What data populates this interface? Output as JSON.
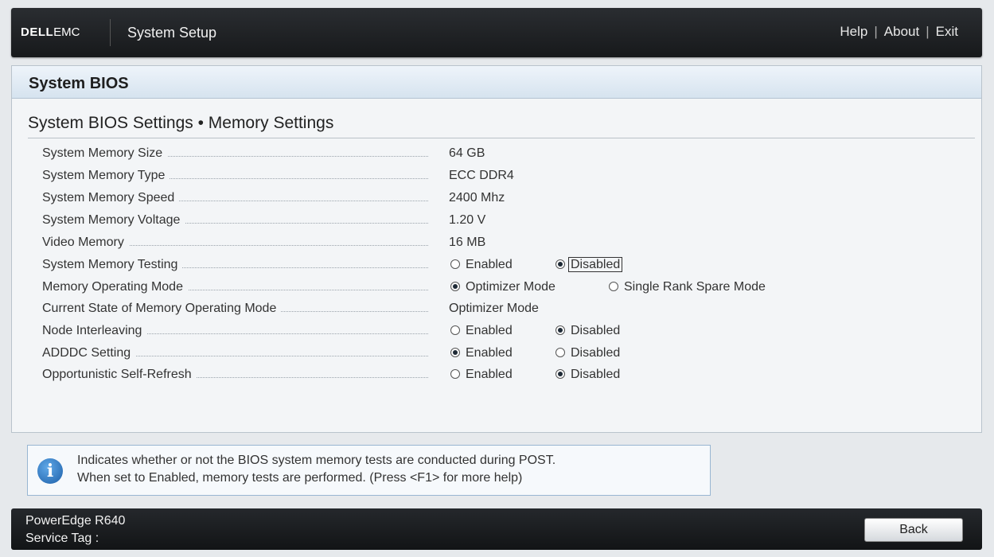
{
  "header": {
    "logo_dell": "DELL",
    "logo_emc": "EMC",
    "app_title": "System Setup",
    "links": [
      "Help",
      "About",
      "Exit"
    ],
    "separator": "|"
  },
  "panel": {
    "title": "System BIOS",
    "section_title": "System BIOS Settings • Memory Settings"
  },
  "settings": {
    "memory_size": {
      "label": "System Memory Size",
      "value": "64 GB"
    },
    "memory_type": {
      "label": "System Memory Type",
      "value": "ECC DDR4"
    },
    "memory_speed": {
      "label": "System Memory Speed",
      "value": "2400 Mhz"
    },
    "memory_voltage": {
      "label": "System Memory Voltage",
      "value": "1.20 V"
    },
    "video_memory": {
      "label": "Video Memory",
      "value": "16 MB"
    },
    "memory_testing": {
      "label": "System Memory Testing",
      "options": [
        "Enabled",
        "Disabled"
      ],
      "selected": "Disabled"
    },
    "operating_mode": {
      "label": "Memory Operating Mode",
      "options": [
        "Optimizer Mode",
        "Single Rank Spare Mode"
      ],
      "selected": "Optimizer Mode"
    },
    "current_mode": {
      "label": "Current State of Memory Operating Mode",
      "value": "Optimizer Mode"
    },
    "node_interleaving": {
      "label": "Node Interleaving",
      "options": [
        "Enabled",
        "Disabled"
      ],
      "selected": "Disabled"
    },
    "adddc": {
      "label": "ADDDC Setting",
      "options": [
        "Enabled",
        "Disabled"
      ],
      "selected": "Enabled"
    },
    "self_refresh": {
      "label": "Opportunistic Self-Refresh",
      "options": [
        "Enabled",
        "Disabled"
      ],
      "selected": "Disabled"
    }
  },
  "help": {
    "icon": "info-icon",
    "line1": "Indicates whether or not the BIOS system memory tests are conducted during POST.",
    "line2": "When set to Enabled, memory tests are performed. (Press <F1> for more help)"
  },
  "footer": {
    "model": "PowerEdge R640",
    "service_tag_label": "Service Tag :",
    "back_label": "Back"
  }
}
